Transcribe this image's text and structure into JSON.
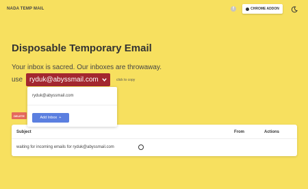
{
  "header": {
    "brand": "NADA TEMP MAIL",
    "facebook_glyph": "f",
    "chrome_addon_label": "CHROME ADDON",
    "icons": [
      "facebook-icon",
      "chrome-icon",
      "moon-icon"
    ]
  },
  "hero": {
    "title": "Disposable Temporary Email",
    "subtitle": "Your inbox is sacred. Our inboxes are throwaway.",
    "use_label": "use",
    "current_email": "ryduk@abyssmail.com",
    "copy_hint": "click to copy"
  },
  "dropdown": {
    "items": [
      "ryduk@abyssmail.com"
    ],
    "add_inbox_label": "Add Inbox",
    "add_inbox_glyph": "+"
  },
  "actions": {
    "delete_label": "DELETE"
  },
  "table": {
    "columns": [
      "Subject",
      "From",
      "Actions"
    ],
    "waiting_message": "waiting for incoming emails for ryduk@abyssmail.com"
  },
  "colors": {
    "background": "#f7e05f",
    "email_pill": "#a3272f",
    "add_button": "#5b7fe0",
    "delete_badge": "#e56a5c"
  }
}
